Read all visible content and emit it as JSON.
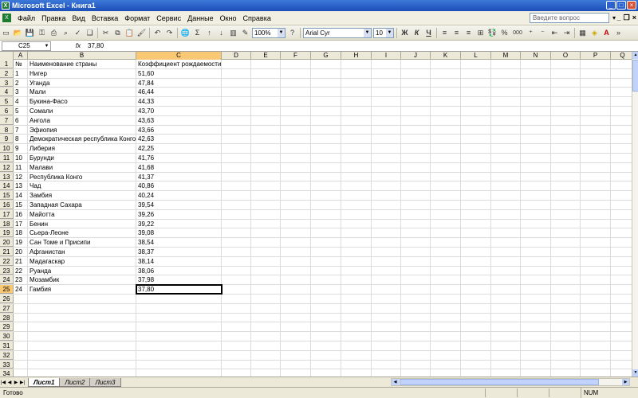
{
  "window": {
    "title": "Microsoft Excel - Книга1"
  },
  "menu": {
    "items": [
      "Файл",
      "Правка",
      "Вид",
      "Вставка",
      "Формат",
      "Сервис",
      "Данные",
      "Окно",
      "Справка"
    ],
    "help_placeholder": "Введите вопрос"
  },
  "toolbar": {
    "zoom": "100%",
    "font_name": "Arial Cyr",
    "font_size": "10",
    "bold_label": "Ж",
    "italic_label": "К",
    "underline_label": "Ч",
    "percent_label": "%",
    "thousands_label": "000",
    "sigma_label": "Σ"
  },
  "formula_bar": {
    "name_box": "C25",
    "fx_label": "fx",
    "value": "37,80"
  },
  "grid": {
    "columns": [
      "A",
      "B",
      "C",
      "D",
      "E",
      "F",
      "G",
      "H",
      "I",
      "J",
      "K",
      "L",
      "M",
      "N",
      "O",
      "P",
      "Q"
    ],
    "selected_column": "C",
    "selected_row": 25,
    "rows": [
      [
        "№",
        "Наименование страны",
        "Коэффициент  рождаемости"
      ],
      [
        "1",
        "Нигер",
        "51,60"
      ],
      [
        "2",
        "Уганда",
        "47,84"
      ],
      [
        "3",
        "Мали",
        "46,44"
      ],
      [
        "4",
        "Букина-Фасо",
        "44,33"
      ],
      [
        "5",
        "Сомали",
        "43,70"
      ],
      [
        "6",
        "Ангола",
        "43,63"
      ],
      [
        "7",
        "Эфиопия",
        "43,66"
      ],
      [
        "8",
        "Демократическая республика Конго",
        "42,63"
      ],
      [
        "9",
        "Либерия",
        "42,25"
      ],
      [
        "10",
        "Бурунди",
        "41,76"
      ],
      [
        "11",
        "Малави",
        "41,68"
      ],
      [
        "12",
        "Республика Конго",
        "41,37"
      ],
      [
        "13",
        "Чад",
        "40,86"
      ],
      [
        "14",
        "Замбия",
        "40,24"
      ],
      [
        "15",
        "Западная Сахара",
        "39,54"
      ],
      [
        "16",
        "Майотта",
        "39,26"
      ],
      [
        "17",
        "Бенин",
        "39,22"
      ],
      [
        "18",
        "Сьера-Леоне",
        "39,08"
      ],
      [
        "19",
        "Сан Томе и Присипи",
        "38,54"
      ],
      [
        "20",
        "Афганистан",
        "38,37"
      ],
      [
        "21",
        "Мадагаскар",
        "38,14"
      ],
      [
        "22",
        "Руанда",
        "38,06"
      ],
      [
        "23",
        "Мозамбик",
        "37,98"
      ],
      [
        "24",
        "Гамбия",
        "37,80"
      ],
      [
        "",
        "",
        ""
      ],
      [
        "",
        "",
        ""
      ],
      [
        "",
        "",
        ""
      ],
      [
        "",
        "",
        ""
      ],
      [
        "",
        "",
        ""
      ],
      [
        "",
        "",
        ""
      ],
      [
        "",
        "",
        ""
      ],
      [
        "",
        "",
        ""
      ],
      [
        "",
        "",
        ""
      ]
    ]
  },
  "sheets": [
    {
      "label": "Лист1",
      "active": true
    },
    {
      "label": "Лист2",
      "active": false
    },
    {
      "label": "Лист3",
      "active": false
    }
  ],
  "status": {
    "text": "Готово",
    "num": "NUM"
  }
}
